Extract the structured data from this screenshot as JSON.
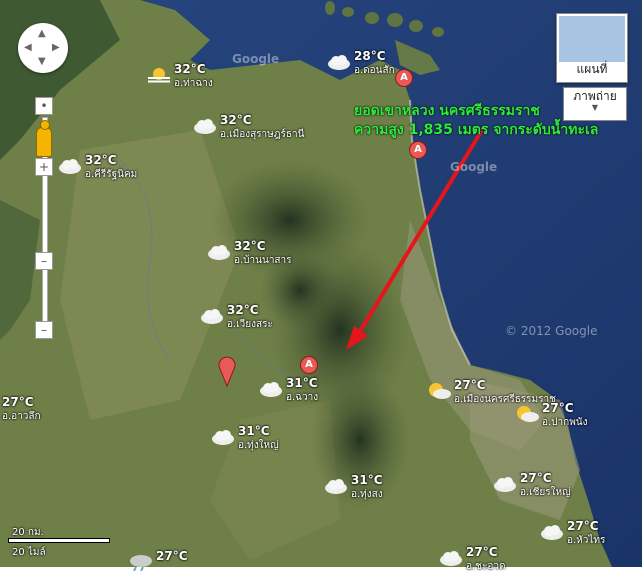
{
  "map_type": {
    "map_label": "แผนที่",
    "satellite_label": "ภาพถ่าย"
  },
  "annotation": {
    "line1": "ยอดเขาหลวง นครศรีธรรมราช",
    "line2": "ความสูง 1,835 เมตร จากระดับน้ำทะเล",
    "arrow_color": "#e8141b",
    "text_color": "#2eea3b"
  },
  "copyright": "© 2012 Google",
  "watermark": "Google",
  "scale": {
    "km": "20 กม.",
    "mi": "20 ไมล์"
  },
  "weather": [
    {
      "id": "thachana",
      "temp": "32°C",
      "name": "อ.ท่าฉาง",
      "icon": "haze-sun-icon"
    },
    {
      "id": "donsak",
      "temp": "28°C",
      "name": "อ.ดอนสัก",
      "icon": "cloud-icon"
    },
    {
      "id": "surat",
      "temp": "32°C",
      "name": "อ.เมืองสุราษฎร์ธานี",
      "icon": "cloud-icon"
    },
    {
      "id": "khirirat",
      "temp": "32°C",
      "name": "อ.คีรีรัฐนิคม",
      "icon": "cloud-icon"
    },
    {
      "id": "bannasan",
      "temp": "32°C",
      "name": "อ.บ้านนาสาร",
      "icon": "cloud-icon"
    },
    {
      "id": "wiangsa",
      "temp": "32°C",
      "name": "อ.เวียงสระ",
      "icon": "cloud-icon"
    },
    {
      "id": "chawang",
      "temp": "31°C",
      "name": "อ.ฉวาง",
      "icon": "cloud-icon"
    },
    {
      "id": "aolak",
      "temp": "27°C",
      "name": "อ.อาวลึก",
      "icon": "none"
    },
    {
      "id": "thungyai",
      "temp": "31°C",
      "name": "อ.ทุ่งใหญ่",
      "icon": "cloud-icon"
    },
    {
      "id": "nakhon",
      "temp": "27°C",
      "name": "อ.เมืองนครศรีธรรมราช",
      "icon": "partly-sunny-icon"
    },
    {
      "id": "pakphanang",
      "temp": "27°C",
      "name": "อ.ปากพนัง",
      "icon": "partly-sunny-icon"
    },
    {
      "id": "thungsong",
      "temp": "31°C",
      "name": "อ.ทุ่งสง",
      "icon": "cloud-icon"
    },
    {
      "id": "chianyai",
      "temp": "27°C",
      "name": "อ.เชียรใหญ่",
      "icon": "cloud-icon"
    },
    {
      "id": "huasai",
      "temp": "27°C",
      "name": "อ.หัวไทร",
      "icon": "cloud-icon"
    },
    {
      "id": "bottom1",
      "temp": "27°C",
      "name": "",
      "icon": "rain-icon"
    },
    {
      "id": "bottom2",
      "temp": "27°C",
      "name": "อ.ชะอวด",
      "icon": "cloud-icon"
    }
  ],
  "markers": [
    {
      "id": "donsak-marker",
      "label": "A"
    },
    {
      "id": "coast-marker",
      "label": "A"
    },
    {
      "id": "chawang-marker",
      "label": "A"
    }
  ],
  "colors": {
    "sea": "#1f3f7a",
    "land": "#6f7f48",
    "mountain": "#2f4028"
  }
}
